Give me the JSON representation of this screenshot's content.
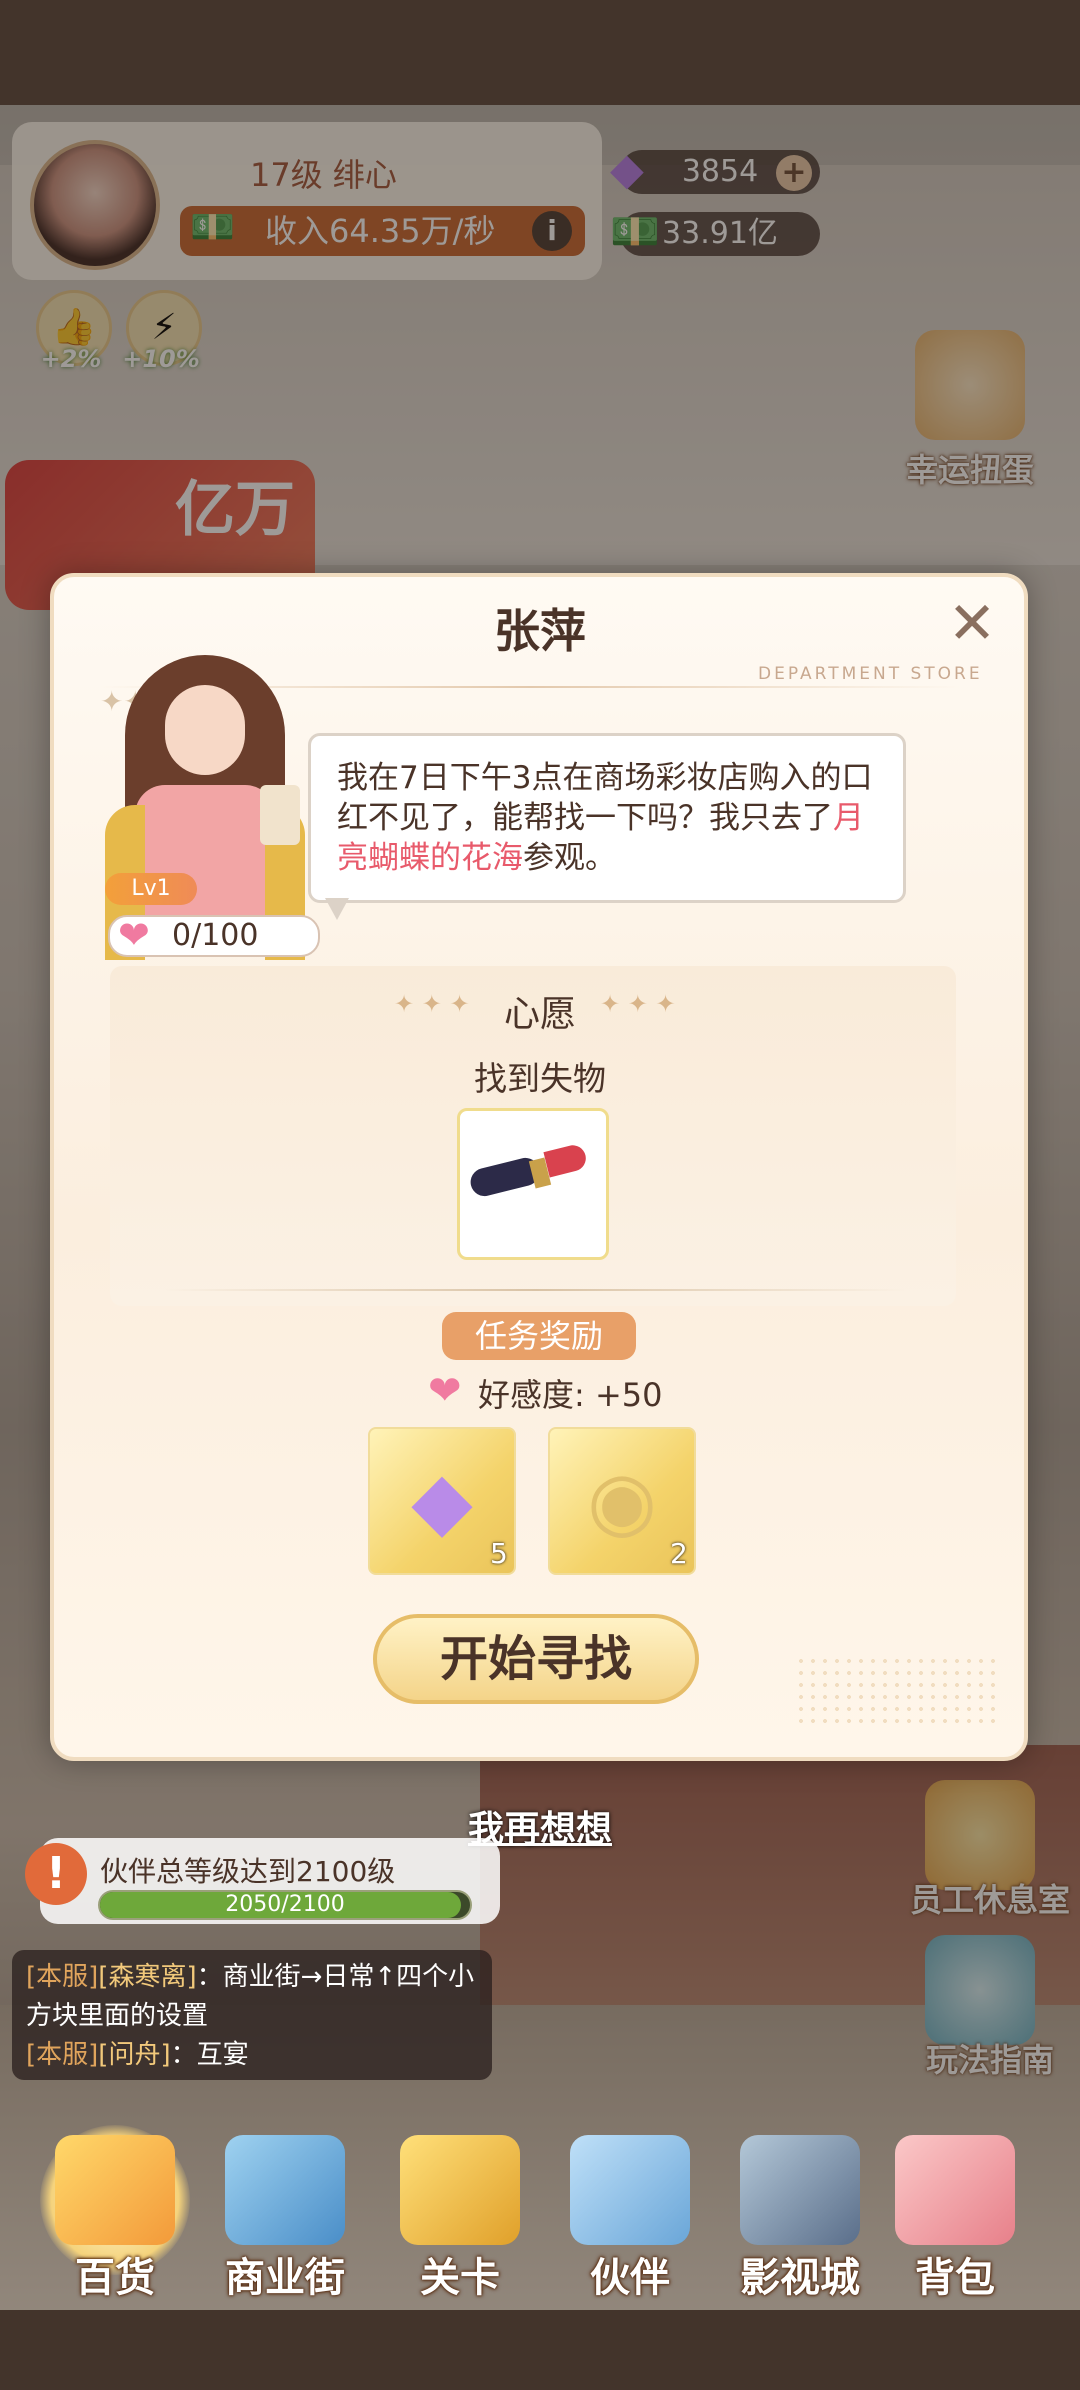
{
  "hud": {
    "level_name": "17级   绯心",
    "income": "收入64.35万/秒",
    "gems": "3854",
    "cash": "33.91亿",
    "buffs": [
      {
        "label": "+2%"
      },
      {
        "label": "+10%"
      }
    ],
    "side_buttons": [
      {
        "label": "幸运扭蛋"
      }
    ],
    "promo_text": "亿万"
  },
  "dialog": {
    "title": "张萍",
    "subtitle": "DEPARTMENT STORE",
    "level": "Lv1",
    "affection": "0/100",
    "message_before": "我在7日下午3点在商场彩妆店购入的口红不见了，能帮找一下吗？我只去了",
    "message_highlight": "月亮蝴蝶的花海",
    "message_after": "参观。",
    "wish_title": "心愿",
    "wish_task": "找到失物",
    "reward_tag": "任务奖励",
    "reward_affection": "好感度: +50",
    "rewards": [
      {
        "icon": "diamond-icon",
        "count": "5"
      },
      {
        "icon": "coin-icon",
        "count": "2"
      }
    ],
    "start_button": "开始寻找",
    "think_link": "我再想想"
  },
  "task": {
    "text": "伙伴总等级达到2100级",
    "progress_text": "2050/2100",
    "progress": 0.976
  },
  "right_buttons": [
    {
      "label": "员工休息室"
    },
    {
      "label": "玩法指南"
    }
  ],
  "chat": [
    {
      "tag": "[本服]",
      "nick": "[森寒离]",
      "text": "：商业街→日常↑四个小方块里面的设置"
    },
    {
      "tag": "[本服]",
      "nick": "[问舟]",
      "text": "：互宴"
    }
  ],
  "nav": [
    {
      "label": "百货",
      "icon": "store-icon",
      "active": true
    },
    {
      "label": "商业街",
      "icon": "city-icon",
      "active": false
    },
    {
      "label": "关卡",
      "icon": "truck-icon",
      "active": false
    },
    {
      "label": "伙伴",
      "icon": "partner-icon",
      "active": false
    },
    {
      "label": "影视城",
      "icon": "film-icon",
      "active": false
    },
    {
      "label": "背包",
      "icon": "bag-icon",
      "active": false
    }
  ],
  "colors": {
    "accent": "#e8a068",
    "highlight": "#e85a6b",
    "progress": "#6ea83a"
  }
}
